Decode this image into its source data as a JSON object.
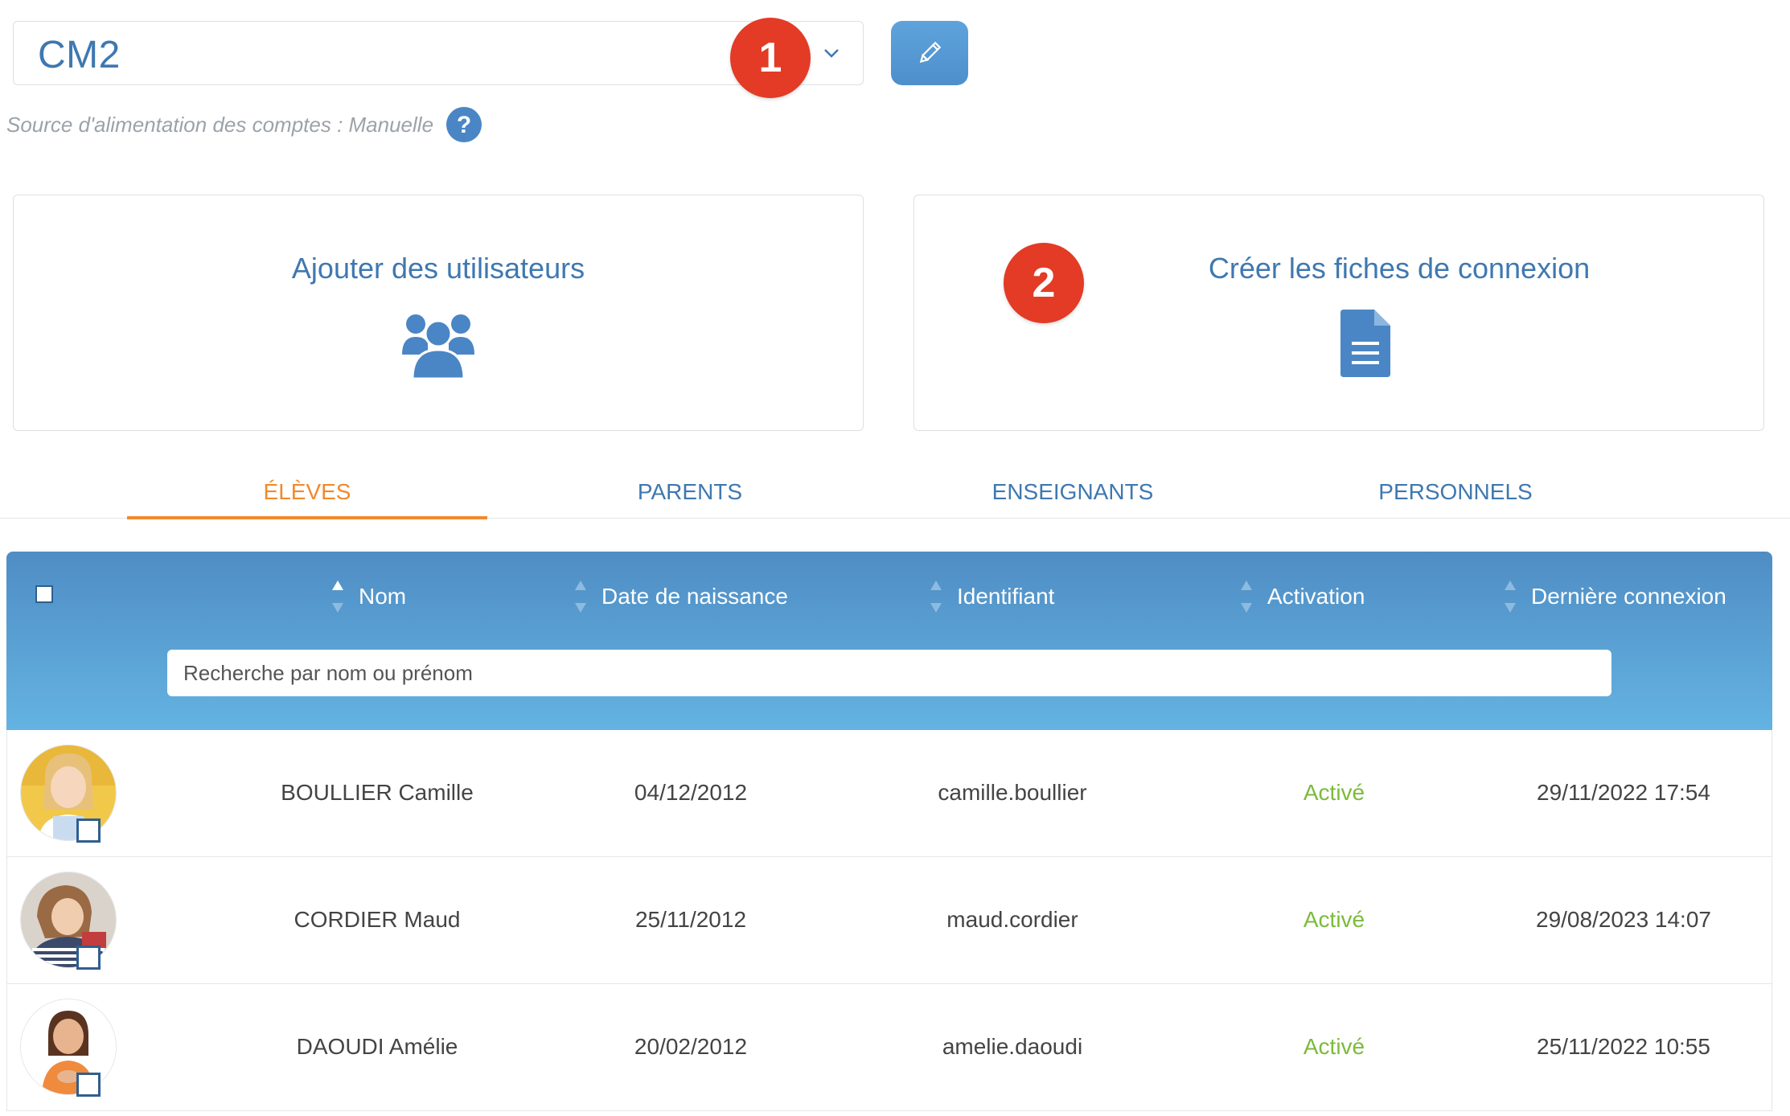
{
  "class_selector": {
    "value": "CM2",
    "marker": "1"
  },
  "source_text": "Source d'alimentation des comptes : Manuelle",
  "cards": {
    "add_users": {
      "title": "Ajouter des utilisateurs"
    },
    "login_sheets": {
      "title": "Créer les fiches de connexion",
      "marker": "2"
    }
  },
  "tabs": [
    {
      "label": "ÉLÈVES",
      "active": true
    },
    {
      "label": "PARENTS",
      "active": false
    },
    {
      "label": "ENSEIGNANTS",
      "active": false
    },
    {
      "label": "PERSONNELS",
      "active": false
    }
  ],
  "table": {
    "columns": [
      "Nom",
      "Date de naissance",
      "Identifiant",
      "Activation",
      "Dernière connexion"
    ],
    "search_placeholder": "Recherche par nom ou prénom",
    "rows": [
      {
        "name": "BOULLIER Camille",
        "birthdate": "04/12/2012",
        "login": "camille.boullier",
        "activation": "Activé",
        "last_login": "29/11/2022 17:54"
      },
      {
        "name": "CORDIER Maud",
        "birthdate": "25/11/2012",
        "login": "maud.cordier",
        "activation": "Activé",
        "last_login": "29/08/2023 14:07"
      },
      {
        "name": "DAOUDI Amélie",
        "birthdate": "20/02/2012",
        "login": "amelie.daoudi",
        "activation": "Activé",
        "last_login": "25/11/2022 10:55"
      }
    ]
  },
  "colors": {
    "accent": "#3f78b0",
    "marker": "#e33b26",
    "active_tab": "#f08a2c",
    "activation_ok": "#7bbb3a",
    "header_gradient_top": "#4f8dc4",
    "header_gradient_bottom": "#64b3e2"
  }
}
